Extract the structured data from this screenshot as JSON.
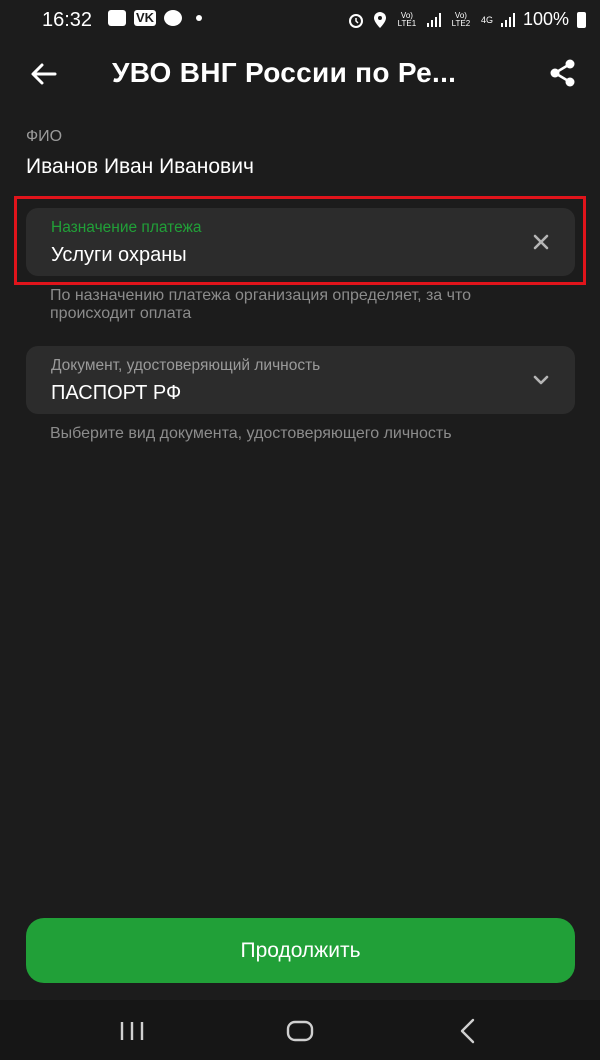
{
  "status_bar": {
    "time": "16:32",
    "vk": "VK",
    "battery": "100%",
    "sim1": "Vo) LTE1",
    "sim2": "Vo) LTE2",
    "net": "4G"
  },
  "app_bar": {
    "title": "УВО ВНГ России по Ре..."
  },
  "fio": {
    "label": "ФИО",
    "value": "Иванов Иван Иванович"
  },
  "purpose_field": {
    "label": "Назначение платежа",
    "value": "Услуги охраны",
    "hint": "По назначению платежа организация определяет, за что происходит оплата"
  },
  "document_field": {
    "label": "Документ, удостоверяющий личность",
    "value": "ПАСПОРТ РФ",
    "hint": "Выберите вид документа, удостоверяющего личность"
  },
  "continue_button": {
    "label": "Продолжить"
  },
  "colors": {
    "accent": "#21a038",
    "highlight": "#e0141b",
    "background": "#1c1c1c",
    "field_bg": "#2c2c2c"
  },
  "icons": [
    "arrow-left-icon",
    "share-icon",
    "close-icon",
    "chevron-down-icon",
    "recents-icon",
    "home-icon",
    "back-nav-icon"
  ]
}
